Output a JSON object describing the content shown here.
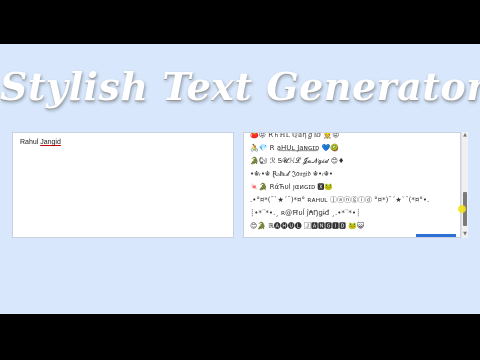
{
  "page": {
    "title": "Stylish Text Generator"
  },
  "input": {
    "value_first": "Rahul",
    "value_second": "Jangid"
  },
  "output": {
    "rows": [
      "🍅😡 R♄ℍ𝕃 ℚ𝕒ηℊ𝕚ⅆ 👷😡",
      "🚴💎 R a͟H͟U͟ʟ͟ ͟J͟a͟ɴ͟ɢ͟ɪ͟ᴅ 💙🥝",
      "🐊🐿 ℛ Ꭶ𝓤ℋ𝓛 𝓙𝓪𝓝ℊ𝓲𝓭 😊♦",
      "•☬ᵣ•☬ Ɽₐ𝐡ᵤ𝓵 𝔍𝔞𝔫𝔤𝔦𝔡 ☬•ᵣ☬•",
      "🍬🐊 RάЋυl ȷαиɢɪᴅ 🆇🐸",
      ".•°¤*(¯`★´¯)*¤° ʀᴀʜᴜʟ ⓙⓐⓝⓖⓘⓓ °¤*)¯´★`¯(*¤°•.",
      "┊•*¨*•.¸ ʀ@Ħυĺ ĵ₳Ŋǥɨđ ¸.•*¨*•┊",
      "😊🐊 ℝ🅐🅗🅤🅛 🄹🅰🅽🅶🅸🅳 🐸😺"
    ]
  },
  "colors": {
    "background": "#d8e7fb",
    "panel": "#ffffff",
    "accent": "#2e6fd6",
    "letterbox": "#000000"
  }
}
